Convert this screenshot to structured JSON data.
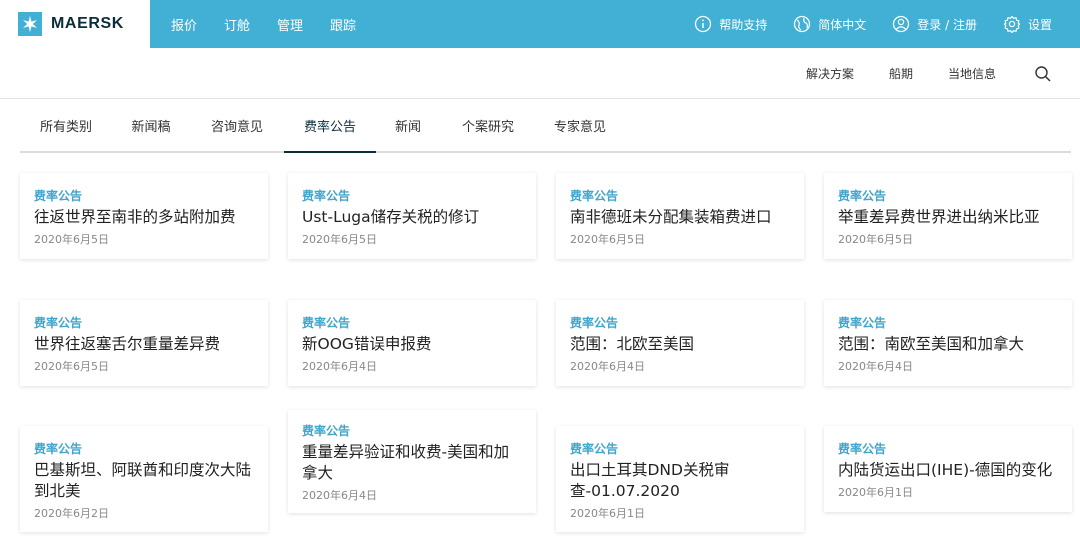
{
  "brand": {
    "name": "MAERSK",
    "color": "#42b0d5"
  },
  "main_nav": [
    "报价",
    "订舱",
    "管理",
    "跟踪"
  ],
  "utility_nav": {
    "help": "帮助支持",
    "language": "简体中文",
    "login": "登录 / 注册",
    "settings": "设置"
  },
  "secondary_nav": [
    "解决方案",
    "船期",
    "当地信息"
  ],
  "tabs": [
    {
      "label": "所有类别",
      "active": false
    },
    {
      "label": "新闻稿",
      "active": false
    },
    {
      "label": "咨询意见",
      "active": false
    },
    {
      "label": "费率公告",
      "active": true
    },
    {
      "label": "新闻",
      "active": false
    },
    {
      "label": "个案研究",
      "active": false
    },
    {
      "label": "专家意见",
      "active": false
    }
  ],
  "cards": [
    {
      "category": "费率公告",
      "title": "往返世界至南非的多站附加费",
      "date": "2020年6月5日"
    },
    {
      "category": "费率公告",
      "title": "Ust-Luga储存关税的修订",
      "date": "2020年6月5日"
    },
    {
      "category": "费率公告",
      "title": "南非德班未分配集装箱费进口",
      "date": "2020年6月5日"
    },
    {
      "category": "费率公告",
      "title": "举重差异费世界进出纳米比亚",
      "date": "2020年6月5日"
    },
    {
      "category": "费率公告",
      "title": "世界往返塞舌尔重量差异费",
      "date": "2020年6月5日"
    },
    {
      "category": "费率公告",
      "title": "新OOG错误申报费",
      "date": "2020年6月4日"
    },
    {
      "category": "费率公告",
      "title": "范围：北欧至美国",
      "date": "2020年6月4日"
    },
    {
      "category": "费率公告",
      "title": "范围：南欧至美国和加拿大",
      "date": "2020年6月4日"
    },
    {
      "category": "费率公告",
      "title": "巴基斯坦、阿联酋和印度次大陆到北美",
      "date": "2020年6月2日"
    },
    {
      "category": "费率公告",
      "title": "重量差异验证和收费-美国和加拿大",
      "date": "2020年6月4日"
    },
    {
      "category": "费率公告",
      "title": "出口土耳其DND关税审查-01.07.2020",
      "date": "2020年6月1日"
    },
    {
      "category": "费率公告",
      "title": "内陆货运出口(IHE)-德国的变化",
      "date": "2020年6月1日"
    }
  ]
}
